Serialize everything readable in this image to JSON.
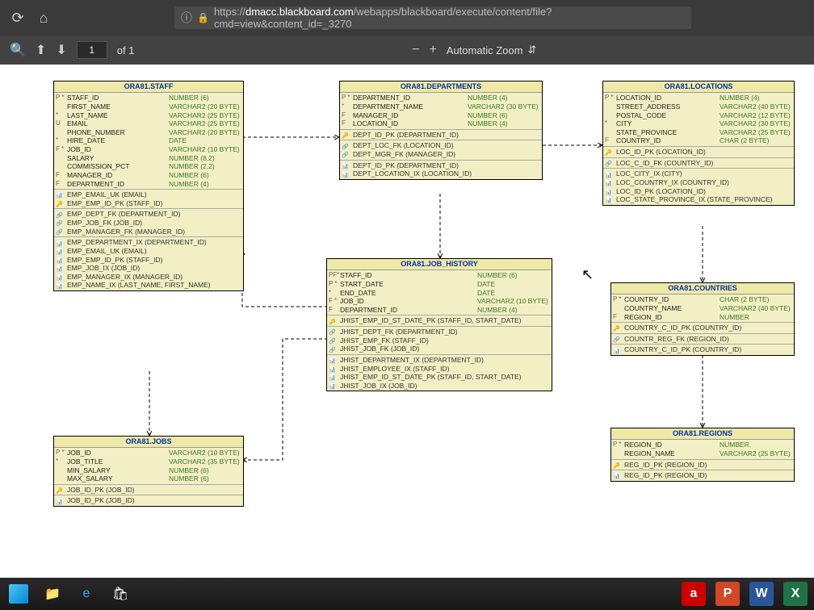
{
  "browser": {
    "url_prefix": "https://",
    "url_host": "dmacc.blackboard.com",
    "url_path": "/webapps/blackboard/execute/content/file?cmd=view&content_id=_3270"
  },
  "pdf": {
    "page_value": "1",
    "of_label": "of 1",
    "zoom_label": "Automatic Zoom"
  },
  "tables": {
    "staff": {
      "title": "ORA81.STAFF",
      "cols": [
        {
          "m": "P *",
          "n": "STAFF_ID",
          "t": "NUMBER (6)"
        },
        {
          "m": "",
          "n": "FIRST_NAME",
          "t": "VARCHAR2 (20 BYTE)"
        },
        {
          "m": "*",
          "n": "LAST_NAME",
          "t": "VARCHAR2 (25 BYTE)"
        },
        {
          "m": "U",
          "n": "EMAIL",
          "t": "VARCHAR2 (25 BYTE)"
        },
        {
          "m": "",
          "n": "PHONE_NUMBER",
          "t": "VARCHAR2 (20 BYTE)"
        },
        {
          "m": "*",
          "n": "HIRE_DATE",
          "t": "DATE"
        },
        {
          "m": "F *",
          "n": "JOB_ID",
          "t": "VARCHAR2 (10 BYTE)"
        },
        {
          "m": "",
          "n": "SALARY",
          "t": "NUMBER (8,2)"
        },
        {
          "m": "",
          "n": "COMMISSION_PCT",
          "t": "NUMBER (2,2)"
        },
        {
          "m": "F",
          "n": "MANAGER_ID",
          "t": "NUMBER (6)"
        },
        {
          "m": "F",
          "n": "DEPARTMENT_ID",
          "t": "NUMBER (4)"
        }
      ],
      "sec2": [
        {
          "ic": "ix",
          "n": "EMP_EMAIL_UK (EMAIL)"
        },
        {
          "ic": "pk",
          "n": "EMP_EMP_ID_PK (STAFF_ID)"
        }
      ],
      "sec3": [
        {
          "ic": "fk",
          "n": "EMP_DEPT_FK (DEPARTMENT_ID)"
        },
        {
          "ic": "fk",
          "n": "EMP_JOB_FK (JOB_ID)"
        },
        {
          "ic": "fk",
          "n": "EMP_MANAGER_FK (MANAGER_ID)"
        }
      ],
      "sec4": [
        {
          "ic": "ix",
          "n": "EMP_DEPARTMENT_IX (DEPARTMENT_ID)"
        },
        {
          "ic": "ix",
          "n": "EMP_EMAIL_UK (EMAIL)"
        },
        {
          "ic": "ix",
          "n": "EMP_EMP_ID_PK (STAFF_ID)"
        },
        {
          "ic": "ix",
          "n": "EMP_JOB_IX (JOB_ID)"
        },
        {
          "ic": "ix",
          "n": "EMP_MANAGER_IX (MANAGER_ID)"
        },
        {
          "ic": "ix",
          "n": "EMP_NAME_IX (LAST_NAME, FIRST_NAME)"
        }
      ]
    },
    "departments": {
      "title": "ORA81.DEPARTMENTS",
      "cols": [
        {
          "m": "P *",
          "n": "DEPARTMENT_ID",
          "t": "NUMBER (4)"
        },
        {
          "m": "*",
          "n": "DEPARTMENT_NAME",
          "t": "VARCHAR2 (30 BYTE)"
        },
        {
          "m": "F",
          "n": "MANAGER_ID",
          "t": "NUMBER (6)"
        },
        {
          "m": "F",
          "n": "LOCATION_ID",
          "t": "NUMBER (4)"
        }
      ],
      "sec2": [
        {
          "ic": "pk",
          "n": "DEPT_ID_PK (DEPARTMENT_ID)"
        }
      ],
      "sec3": [
        {
          "ic": "fk",
          "n": "DEPT_LOC_FK (LOCATION_ID)"
        },
        {
          "ic": "fk",
          "n": "DEPT_MGR_FK (MANAGER_ID)"
        }
      ],
      "sec4": [
        {
          "ic": "ix",
          "n": "DEPT_ID_PK (DEPARTMENT_ID)"
        },
        {
          "ic": "ix",
          "n": "DEPT_LOCATION_IX (LOCATION_ID)"
        }
      ]
    },
    "locations": {
      "title": "ORA81.LOCATIONS",
      "cols": [
        {
          "m": "P *",
          "n": "LOCATION_ID",
          "t": "NUMBER (4)"
        },
        {
          "m": "",
          "n": "STREET_ADDRESS",
          "t": "VARCHAR2 (40 BYTE)"
        },
        {
          "m": "",
          "n": "POSTAL_CODE",
          "t": "VARCHAR2 (12 BYTE)"
        },
        {
          "m": "*",
          "n": "CITY",
          "t": "VARCHAR2 (30 BYTE)"
        },
        {
          "m": "",
          "n": "STATE_PROVINCE",
          "t": "VARCHAR2 (25 BYTE)"
        },
        {
          "m": "F",
          "n": "COUNTRY_ID",
          "t": "CHAR (2 BYTE)"
        }
      ],
      "sec2": [
        {
          "ic": "pk",
          "n": "LOC_ID_PK (LOCATION_ID)"
        }
      ],
      "sec3": [
        {
          "ic": "fk",
          "n": "LOC_C_ID_FK (COUNTRY_ID)"
        }
      ],
      "sec4": [
        {
          "ic": "ix",
          "n": "LOC_CITY_IX (CITY)"
        },
        {
          "ic": "ix",
          "n": "LOC_COUNTRY_IX (COUNTRY_ID)"
        },
        {
          "ic": "ix",
          "n": "LOC_ID_PK (LOCATION_ID)"
        },
        {
          "ic": "ix",
          "n": "LOC_STATE_PROVINCE_IX (STATE_PROVINCE)"
        }
      ]
    },
    "job_history": {
      "title": "ORA81.JOB_HISTORY",
      "cols": [
        {
          "m": "PF*",
          "n": "STAFF_ID",
          "t": "NUMBER (6)"
        },
        {
          "m": "P *",
          "n": "START_DATE",
          "t": "DATE"
        },
        {
          "m": "*",
          "n": "END_DATE",
          "t": "DATE"
        },
        {
          "m": "F *",
          "n": "JOB_ID",
          "t": "VARCHAR2 (10 BYTE)"
        },
        {
          "m": "F",
          "n": "DEPARTMENT_ID",
          "t": "NUMBER (4)"
        }
      ],
      "sec2": [
        {
          "ic": "pk",
          "n": "JHIST_EMP_ID_ST_DATE_PK (STAFF_ID, START_DATE)"
        }
      ],
      "sec3": [
        {
          "ic": "fk",
          "n": "JHIST_DEPT_FK (DEPARTMENT_ID)"
        },
        {
          "ic": "fk",
          "n": "JHIST_EMP_FK (STAFF_ID)"
        },
        {
          "ic": "fk",
          "n": "JHIST_JOB_FK (JOB_ID)"
        }
      ],
      "sec4": [
        {
          "ic": "ix",
          "n": "JHIST_DEPARTMENT_IX (DEPARTMENT_ID)"
        },
        {
          "ic": "ix",
          "n": "JHIST_EMPLOYEE_IX (STAFF_ID)"
        },
        {
          "ic": "ix",
          "n": "JHIST_EMP_ID_ST_DATE_PK (STAFF_ID, START_DATE)"
        },
        {
          "ic": "ix",
          "n": "JHIST_JOB_IX (JOB_ID)"
        }
      ]
    },
    "countries": {
      "title": "ORA81.COUNTRIES",
      "cols": [
        {
          "m": "P *",
          "n": "COUNTRY_ID",
          "t": "CHAR (2 BYTE)"
        },
        {
          "m": "",
          "n": "COUNTRY_NAME",
          "t": "VARCHAR2 (40 BYTE)"
        },
        {
          "m": "F",
          "n": "REGION_ID",
          "t": "NUMBER"
        }
      ],
      "sec2": [
        {
          "ic": "pk",
          "n": "COUNTRY_C_ID_PK (COUNTRY_ID)"
        }
      ],
      "sec3": [
        {
          "ic": "fk",
          "n": "COUNTR_REG_FK (REGION_ID)"
        }
      ],
      "sec4": [
        {
          "ic": "ix",
          "n": "COUNTRY_C_ID_PK (COUNTRY_ID)"
        }
      ]
    },
    "regions": {
      "title": "ORA81.REGIONS",
      "cols": [
        {
          "m": "P *",
          "n": "REGION_ID",
          "t": "NUMBER"
        },
        {
          "m": "",
          "n": "REGION_NAME",
          "t": "VARCHAR2 (25 BYTE)"
        }
      ],
      "sec2": [
        {
          "ic": "pk",
          "n": "REG_ID_PK (REGION_ID)"
        }
      ],
      "sec3": [
        {
          "ic": "ix",
          "n": "REG_ID_PK (REGION_ID)"
        }
      ]
    },
    "jobs": {
      "title": "ORA81.JOBS",
      "cols": [
        {
          "m": "P *",
          "n": "JOB_ID",
          "t": "VARCHAR2 (10 BYTE)"
        },
        {
          "m": "*",
          "n": "JOB_TITLE",
          "t": "VARCHAR2 (35 BYTE)"
        },
        {
          "m": "",
          "n": "MIN_SALARY",
          "t": "NUMBER (6)"
        },
        {
          "m": "",
          "n": "MAX_SALARY",
          "t": "NUMBER (6)"
        }
      ],
      "sec2": [
        {
          "ic": "pk",
          "n": "JOB_ID_PK (JOB_ID)"
        }
      ],
      "sec3": [
        {
          "ic": "ix",
          "n": "JOB_ID_PK (JOB_ID)"
        }
      ]
    }
  }
}
